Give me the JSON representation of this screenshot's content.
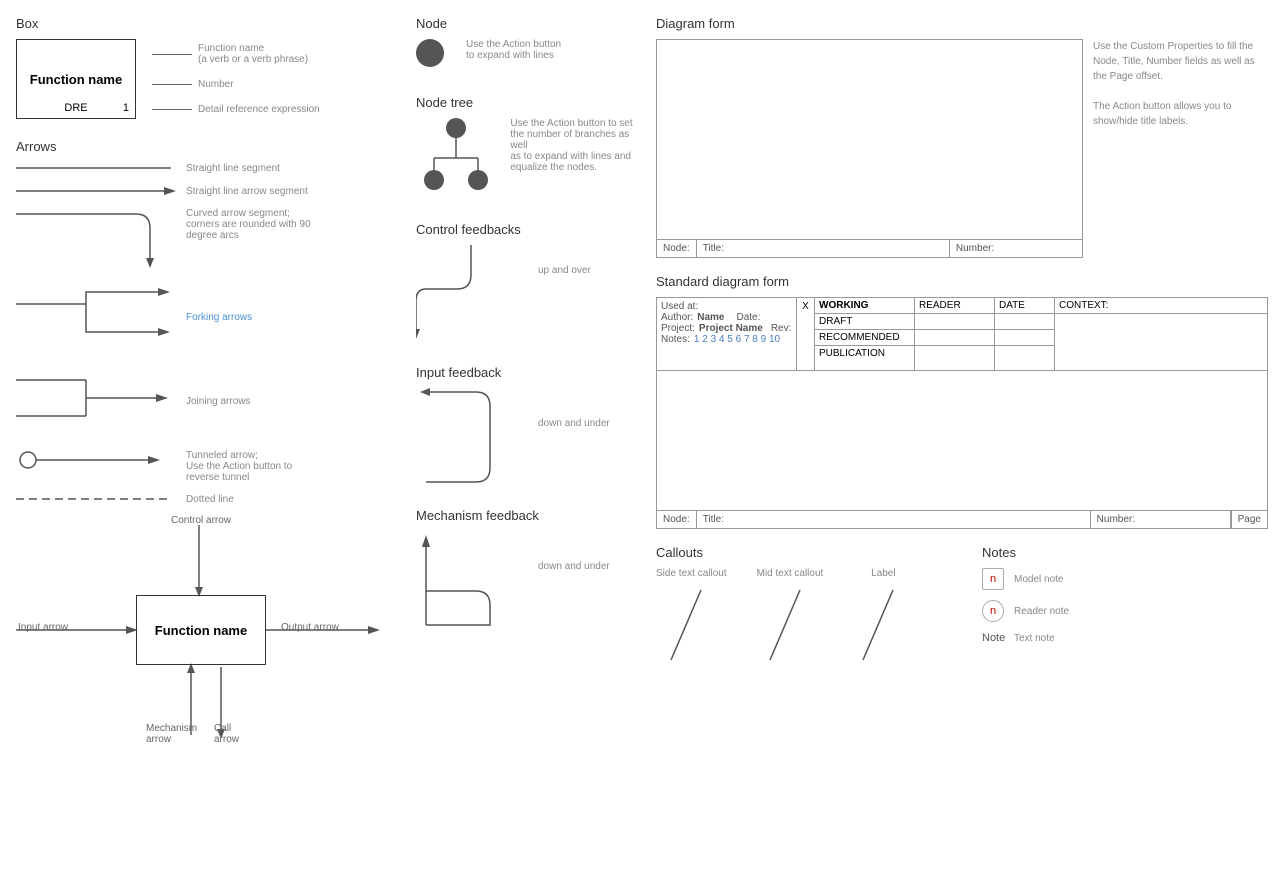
{
  "box": {
    "title": "Box",
    "name": "Function name",
    "number": "1",
    "dre": "DRE",
    "labels": [
      {
        "text": "Function name\n(a verb or a verb phrase)"
      },
      {
        "text": "Number"
      },
      {
        "text": "Detail reference expression"
      }
    ]
  },
  "arrows": {
    "title": "Arrows",
    "items": [
      {
        "type": "straight-line",
        "desc": "Straight line segment"
      },
      {
        "type": "straight-arrow",
        "desc": "Straight line arrow segment"
      },
      {
        "type": "curved-arrow",
        "desc": "Curved arrow segment;\ncorners are rounded with 90\ndegree arcs"
      },
      {
        "type": "forking-arrows",
        "desc": "Forking arrows",
        "blue": true
      },
      {
        "type": "joining-arrows",
        "desc": "Joining arrows",
        "blue": false
      },
      {
        "type": "tunneled-arrow",
        "desc": "Tunneled arrow;\nUse the Action button to\nreverse tunnel"
      },
      {
        "type": "dotted-line",
        "desc": "Dotted line"
      }
    ]
  },
  "bottom_diagram": {
    "box_name": "Function name",
    "control_arrow": "Control arrow",
    "input_arrow": "Input arrow",
    "output_arrow": "Output arrow",
    "mechanism_arrow": "Mechanism arrow",
    "call_arrow": "Call arrow"
  },
  "node": {
    "title": "Node",
    "desc": "Use the Action button\nto expand with lines"
  },
  "node_tree": {
    "title": "Node tree",
    "desc": "Use the Action button to set\nthe number of branches as well\nas to expand with lines and\nequalize the nodes."
  },
  "control_feedbacks": {
    "title": "Control feedbacks",
    "desc": "up and over"
  },
  "input_feedback": {
    "title": "Input feedback",
    "desc": "down and under"
  },
  "mechanism_feedback": {
    "title": "Mechanism feedback",
    "desc": "down and under"
  },
  "diagram_form": {
    "title": "Diagram form",
    "node_label": "Node:",
    "title_label": "Title:",
    "number_label": "Number:",
    "note": "Use the Custom Properties to fill the Node, Title, Number fields as well as the Page offset.\n\nThe Action button allows you to show/hide title labels."
  },
  "standard_diagram_form": {
    "title": "Standard diagram form",
    "used_at": "Used at:",
    "author_label": "Author:",
    "author_value": "Name",
    "date_label": "Date:",
    "project_label": "Project:",
    "project_value": "Project Name",
    "rev_label": "Rev:",
    "notes_label": "Notes:",
    "notes_values": "1 2 3 4 5 6 7 8 9 10",
    "x_label": "X",
    "working": "WORKING",
    "draft": "DRAFT",
    "recommended": "RECOMMENDED",
    "publication": "PUBLICATION",
    "reader_label": "READER",
    "date_col": "DATE",
    "context_label": "CONTEXT:",
    "node_label": "Node:",
    "title_label": "Title:",
    "number_label": "Number:",
    "page_label": "Page"
  },
  "callouts": {
    "title": "Callouts",
    "items": [
      {
        "label": "Side text callout",
        "type": "side"
      },
      {
        "label": "Mid text callout",
        "type": "mid"
      },
      {
        "label": "Label",
        "type": "label"
      }
    ]
  },
  "notes": {
    "title": "Notes",
    "items": [
      {
        "icon": "n",
        "style": "square",
        "label": "Model note"
      },
      {
        "icon": "n",
        "style": "circle",
        "label": "Reader note"
      },
      {
        "icon": "",
        "style": "text",
        "label": "Text note",
        "prefix": "Note"
      }
    ]
  }
}
